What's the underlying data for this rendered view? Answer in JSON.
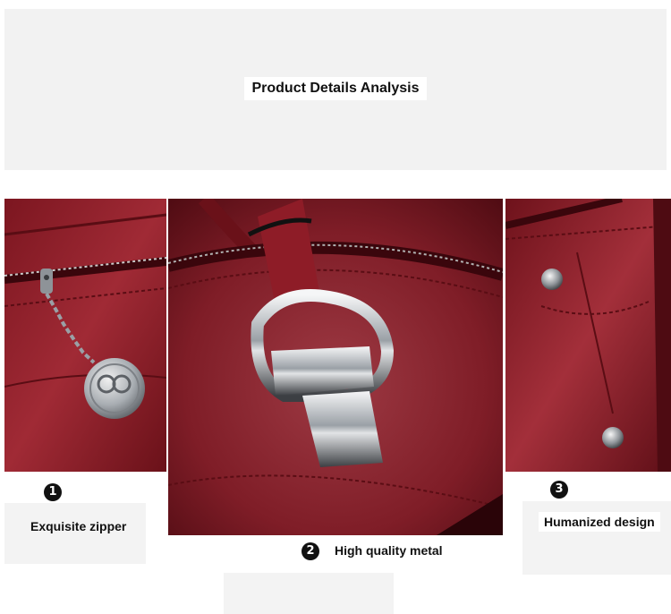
{
  "header": {
    "title": "Product Details Analysis"
  },
  "features": [
    {
      "number": "1",
      "label": "Exquisite zipper"
    },
    {
      "number": "2",
      "label": "High quality metal"
    },
    {
      "number": "3",
      "label": "Humanized design"
    }
  ],
  "colors": {
    "leather": "#8a1a24",
    "leather_dark": "#5a0d14",
    "metal": "#9aa0a6",
    "background": "#ffffff",
    "panel": "#f2f2f2"
  }
}
